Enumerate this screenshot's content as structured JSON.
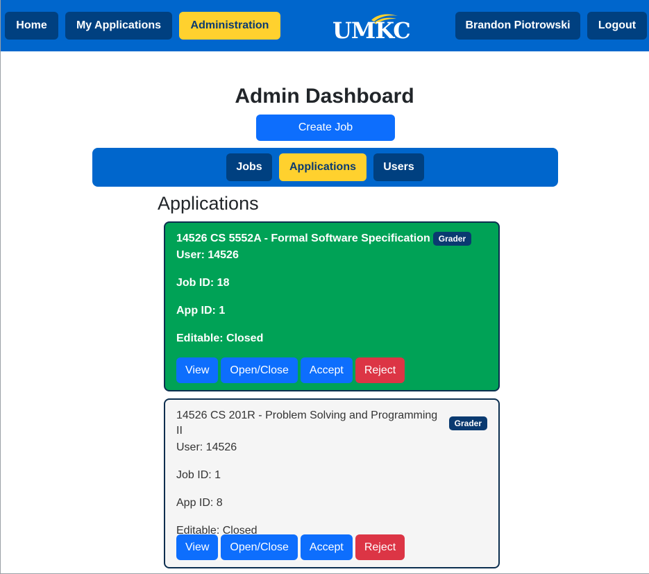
{
  "nav": {
    "home": "Home",
    "my_applications": "My Applications",
    "administration": "Administration",
    "logo": "UMKC",
    "user_name": "Brandon Piotrowski",
    "logout": "Logout"
  },
  "main": {
    "title": "Admin Dashboard",
    "create_job": "Create Job",
    "tabs": [
      {
        "label": "Jobs"
      },
      {
        "label": "Applications"
      },
      {
        "label": "Users"
      }
    ],
    "section_title": "Applications"
  },
  "applications": [
    {
      "title": "14526 CS 5552A - Formal Software Specification",
      "badge": "Grader",
      "user": "User: 14526",
      "job_id": "Job ID: 18",
      "app_id": "App ID: 1",
      "editable": "Editable: Closed",
      "status_color": "#00a256"
    },
    {
      "title": "14526 CS 201R - Problem Solving and Programming II",
      "badge": "Grader",
      "user": "User: 14526",
      "job_id": "Job ID: 1",
      "app_id": "App ID: 8",
      "editable": "Editable: Closed",
      "status_color": "#f5f5f5"
    }
  ],
  "actions": {
    "view": "View",
    "open_close": "Open/Close",
    "accept": "Accept",
    "reject": "Reject"
  },
  "colors": {
    "primary_blue": "#0066cc",
    "dark_blue": "#004080",
    "gold": "#ffd12e",
    "button_blue": "#0d6efd",
    "reject_red": "#dc3545",
    "accepted_green": "#00a256"
  }
}
